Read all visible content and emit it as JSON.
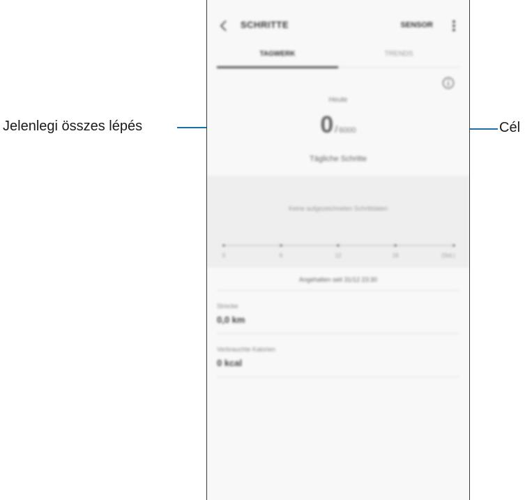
{
  "callouts": {
    "left": "Jelenlegi összes lépés",
    "right": "Cél",
    "line_color": "#1b6fa8"
  },
  "appbar": {
    "back_icon": "chevron-left-icon",
    "title": "SCHRITTE",
    "sensor_label": "SENSOR",
    "more_icon": "more-vertical-icon"
  },
  "tabs": [
    {
      "label": "TAGWERK",
      "active": true
    },
    {
      "label": "TRENDS",
      "active": false
    }
  ],
  "summary": {
    "info_icon": "info-icon",
    "period": "Heute",
    "steps": "0",
    "separator": "/",
    "goal": "6000",
    "steps_label": "Tägliche Schritte"
  },
  "chart": {
    "empty_message": "Keine aufgezeichneten Schrittdaten",
    "ticks": [
      "0",
      "6",
      "12",
      "18",
      "(Std.)"
    ]
  },
  "sync_status": "Angehalten seit 31/12 23:30",
  "stats": [
    {
      "label": "Strecke",
      "value": "0,0 km"
    },
    {
      "label": "Verbrauchte Kalorien",
      "value": "0 kcal"
    }
  ]
}
